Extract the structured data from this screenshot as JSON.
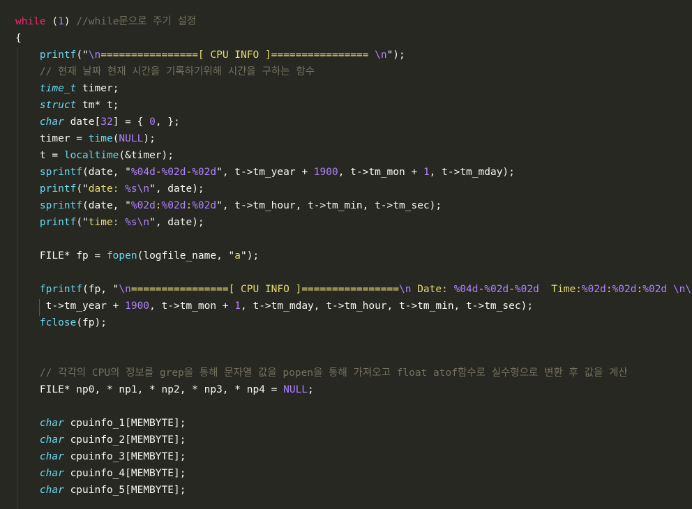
{
  "editor": {
    "lines": [
      [
        {
          "t": "while",
          "c": "kw"
        },
        {
          "t": " (",
          "c": "plain"
        },
        {
          "t": "1",
          "c": "num"
        },
        {
          "t": ") ",
          "c": "plain"
        },
        {
          "t": "//while문으로 주기 설정",
          "c": "cmt"
        }
      ],
      [
        {
          "t": "{",
          "c": "plain"
        }
      ],
      [
        {
          "t": "    ",
          "c": "plain"
        },
        {
          "t": "printf",
          "c": "fn"
        },
        {
          "t": "(\"",
          "c": "plain"
        },
        {
          "t": "\\n",
          "c": "esc"
        },
        {
          "t": "================[ CPU INFO ]================ ",
          "c": "str"
        },
        {
          "t": "\\n",
          "c": "esc"
        },
        {
          "t": "\");",
          "c": "plain"
        }
      ],
      [
        {
          "t": "    ",
          "c": "plain"
        },
        {
          "t": "// 현재 날짜 현재 시간을 기록하기위해 시간을 구하는 함수",
          "c": "cmt"
        }
      ],
      [
        {
          "t": "    ",
          "c": "plain"
        },
        {
          "t": "time_t",
          "c": "type"
        },
        {
          "t": " timer;",
          "c": "plain"
        }
      ],
      [
        {
          "t": "    ",
          "c": "plain"
        },
        {
          "t": "struct",
          "c": "type"
        },
        {
          "t": " tm* t;",
          "c": "plain"
        }
      ],
      [
        {
          "t": "    ",
          "c": "plain"
        },
        {
          "t": "char",
          "c": "type"
        },
        {
          "t": " date[",
          "c": "plain"
        },
        {
          "t": "32",
          "c": "num"
        },
        {
          "t": "] = { ",
          "c": "plain"
        },
        {
          "t": "0",
          "c": "num"
        },
        {
          "t": ", };",
          "c": "plain"
        }
      ],
      [
        {
          "t": "    ",
          "c": "plain"
        },
        {
          "t": "timer = ",
          "c": "plain"
        },
        {
          "t": "time",
          "c": "fn"
        },
        {
          "t": "(",
          "c": "plain"
        },
        {
          "t": "NULL",
          "c": "num"
        },
        {
          "t": ");",
          "c": "plain"
        }
      ],
      [
        {
          "t": "    ",
          "c": "plain"
        },
        {
          "t": "t = ",
          "c": "plain"
        },
        {
          "t": "localtime",
          "c": "fn"
        },
        {
          "t": "(&timer);",
          "c": "plain"
        }
      ],
      [
        {
          "t": "    ",
          "c": "plain"
        },
        {
          "t": "sprintf",
          "c": "fn"
        },
        {
          "t": "(date, \"",
          "c": "plain"
        },
        {
          "t": "%04d",
          "c": "esc"
        },
        {
          "t": "-",
          "c": "str"
        },
        {
          "t": "%02d",
          "c": "esc"
        },
        {
          "t": "-",
          "c": "str"
        },
        {
          "t": "%02d",
          "c": "esc"
        },
        {
          "t": "\", t->tm_year + ",
          "c": "plain"
        },
        {
          "t": "1900",
          "c": "num"
        },
        {
          "t": ", t->tm_mon + ",
          "c": "plain"
        },
        {
          "t": "1",
          "c": "num"
        },
        {
          "t": ", t->tm_mday);",
          "c": "plain"
        }
      ],
      [
        {
          "t": "    ",
          "c": "plain"
        },
        {
          "t": "printf",
          "c": "fn"
        },
        {
          "t": "(\"",
          "c": "plain"
        },
        {
          "t": "date: ",
          "c": "str"
        },
        {
          "t": "%s\\n",
          "c": "esc"
        },
        {
          "t": "\", date);",
          "c": "plain"
        }
      ],
      [
        {
          "t": "    ",
          "c": "plain"
        },
        {
          "t": "sprintf",
          "c": "fn"
        },
        {
          "t": "(date, \"",
          "c": "plain"
        },
        {
          "t": "%02d",
          "c": "esc"
        },
        {
          "t": ":",
          "c": "str"
        },
        {
          "t": "%02d",
          "c": "esc"
        },
        {
          "t": ":",
          "c": "str"
        },
        {
          "t": "%02d",
          "c": "esc"
        },
        {
          "t": "\", t->tm_hour, t->tm_min, t->tm_sec);",
          "c": "plain"
        }
      ],
      [
        {
          "t": "    ",
          "c": "plain"
        },
        {
          "t": "printf",
          "c": "fn"
        },
        {
          "t": "(\"",
          "c": "plain"
        },
        {
          "t": "time: ",
          "c": "str"
        },
        {
          "t": "%s\\n",
          "c": "esc"
        },
        {
          "t": "\", date);",
          "c": "plain"
        }
      ],
      [],
      [
        {
          "t": "    FILE* fp = ",
          "c": "plain"
        },
        {
          "t": "fopen",
          "c": "fn"
        },
        {
          "t": "(logfile_name, \"",
          "c": "plain"
        },
        {
          "t": "a",
          "c": "str"
        },
        {
          "t": "\");",
          "c": "plain"
        }
      ],
      [],
      [
        {
          "t": "    ",
          "c": "plain"
        },
        {
          "t": "fprintf",
          "c": "fn"
        },
        {
          "t": "(fp, \"",
          "c": "plain"
        },
        {
          "t": "\\n",
          "c": "esc"
        },
        {
          "t": "================[ CPU INFO ]================",
          "c": "str"
        },
        {
          "t": "\\n",
          "c": "esc"
        },
        {
          "t": " Date: ",
          "c": "str"
        },
        {
          "t": "%04d",
          "c": "esc"
        },
        {
          "t": "-",
          "c": "str"
        },
        {
          "t": "%02d",
          "c": "esc"
        },
        {
          "t": "-",
          "c": "str"
        },
        {
          "t": "%02d",
          "c": "esc"
        },
        {
          "t": "  Time:",
          "c": "str"
        },
        {
          "t": "%02d",
          "c": "esc"
        },
        {
          "t": ":",
          "c": "str"
        },
        {
          "t": "%02d",
          "c": "esc"
        },
        {
          "t": ":",
          "c": "str"
        },
        {
          "t": "%02d",
          "c": "esc"
        },
        {
          "t": " ",
          "c": "str"
        },
        {
          "t": "\\n\\n",
          "c": "esc"
        },
        {
          "t": "\",",
          "c": "plain"
        }
      ],
      [
        {
          "t": "     t->tm_year + ",
          "c": "plain"
        },
        {
          "t": "1900",
          "c": "num"
        },
        {
          "t": ", t->tm_mon + ",
          "c": "plain"
        },
        {
          "t": "1",
          "c": "num"
        },
        {
          "t": ", t->tm_mday, t->tm_hour, t->tm_min, t->tm_sec);",
          "c": "plain"
        }
      ],
      [
        {
          "t": "    ",
          "c": "plain"
        },
        {
          "t": "fclose",
          "c": "fn"
        },
        {
          "t": "(fp);",
          "c": "plain"
        }
      ],
      [],
      [],
      [
        {
          "t": "    ",
          "c": "plain"
        },
        {
          "t": "// 각각의 CPU의 정보를 grep을 통해 문자열 값을 popen을 통해 가져오고 float atof함수로 실수형으로 변환 후 값을 계산",
          "c": "cmt"
        }
      ],
      [
        {
          "t": "    FILE* np0, * np1, * np2, * np3, * np4 = ",
          "c": "plain"
        },
        {
          "t": "NULL",
          "c": "num"
        },
        {
          "t": ";",
          "c": "plain"
        }
      ],
      [],
      [
        {
          "t": "    ",
          "c": "plain"
        },
        {
          "t": "char",
          "c": "type"
        },
        {
          "t": " cpuinfo_1[MEMBYTE];",
          "c": "plain"
        }
      ],
      [
        {
          "t": "    ",
          "c": "plain"
        },
        {
          "t": "char",
          "c": "type"
        },
        {
          "t": " cpuinfo_2[MEMBYTE];",
          "c": "plain"
        }
      ],
      [
        {
          "t": "    ",
          "c": "plain"
        },
        {
          "t": "char",
          "c": "type"
        },
        {
          "t": " cpuinfo_3[MEMBYTE];",
          "c": "plain"
        }
      ],
      [
        {
          "t": "    ",
          "c": "plain"
        },
        {
          "t": "char",
          "c": "type"
        },
        {
          "t": " cpuinfo_4[MEMBYTE];",
          "c": "plain"
        }
      ],
      [
        {
          "t": "    ",
          "c": "plain"
        },
        {
          "t": "char",
          "c": "type"
        },
        {
          "t": " cpuinfo_5[MEMBYTE];",
          "c": "plain"
        }
      ]
    ]
  },
  "colors": {
    "background": "#272822",
    "keyword": "#f92672",
    "number": "#ae81ff",
    "comment": "#75715e",
    "string": "#e6db74",
    "function": "#66d9ef",
    "text": "#f8f8f2"
  }
}
